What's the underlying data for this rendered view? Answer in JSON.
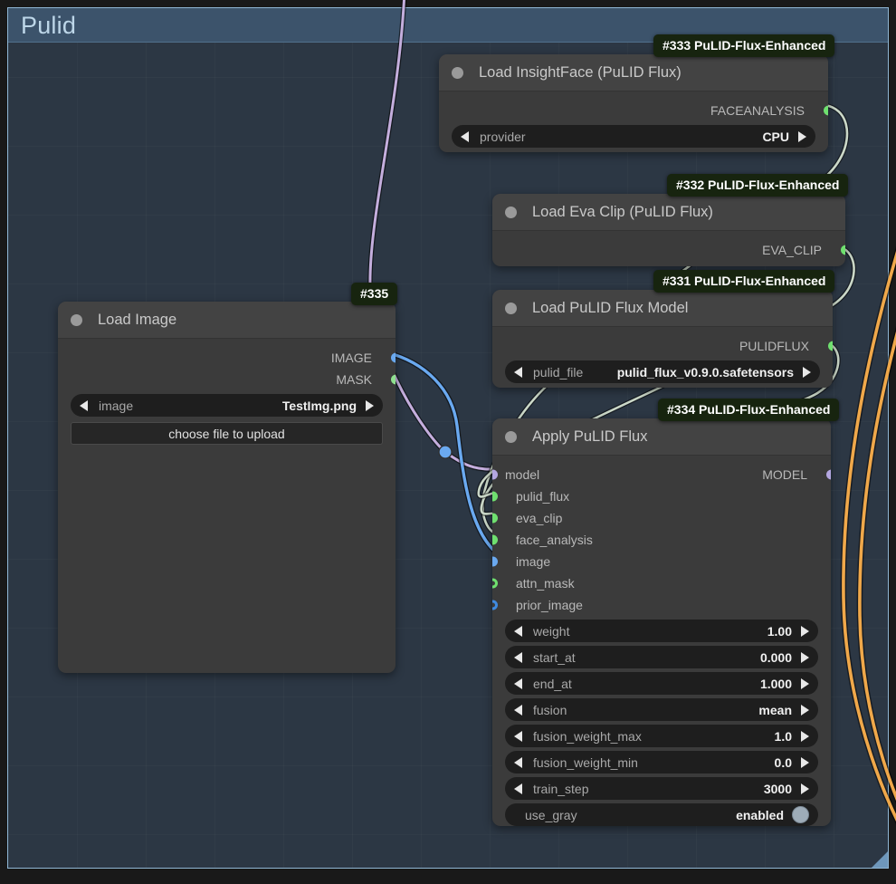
{
  "group": {
    "title": "Pulid",
    "frame_color": "#8fb6d4",
    "header_color": "#3c536b",
    "canvas_color": "#2c3744"
  },
  "colors": {
    "port_green": "#6fe06f",
    "port_blue": "#6aa9f0",
    "port_purple": "#b3a6e0",
    "wire_green": "#cbd8c8",
    "wire_blue": "#6aa9f0",
    "wire_purple": "#c4aedd",
    "wire_orange": "#f0a84a",
    "badge_bg": "#17240f"
  },
  "nodes": [
    {
      "id": "load-insightface",
      "badge": "#333 PuLID-Flux-Enhanced",
      "title": "Load InsightFace (PuLID Flux)",
      "outputs": [
        {
          "label": "FACEANALYSIS",
          "color": "#6fe06f",
          "style": "solid"
        }
      ],
      "inputs": [],
      "widgets": [
        {
          "kind": "combo",
          "label": "provider",
          "value": "CPU"
        }
      ]
    },
    {
      "id": "load-eva-clip",
      "badge": "#332 PuLID-Flux-Enhanced",
      "title": "Load Eva Clip (PuLID Flux)",
      "outputs": [
        {
          "label": "EVA_CLIP",
          "color": "#6fe06f",
          "style": "solid"
        }
      ],
      "inputs": [],
      "widgets": []
    },
    {
      "id": "load-pulid-flux-model",
      "badge": "#331 PuLID-Flux-Enhanced",
      "title": "Load PuLID Flux Model",
      "outputs": [
        {
          "label": "PULIDFLUX",
          "color": "#6fe06f",
          "style": "solid"
        }
      ],
      "inputs": [],
      "widgets": [
        {
          "kind": "combo",
          "label": "pulid_file",
          "value": "pulid_flux_v0.9.0.safetensors"
        }
      ]
    },
    {
      "id": "load-image",
      "badge": "#335",
      "title": "Load Image",
      "outputs": [
        {
          "label": "IMAGE",
          "color": "#6aa9f0",
          "style": "solid"
        },
        {
          "label": "MASK",
          "color": "#8fe08f",
          "style": "solid"
        }
      ],
      "inputs": [],
      "widgets": [
        {
          "kind": "combo",
          "label": "image",
          "value": "TestImg.png"
        },
        {
          "kind": "button",
          "label": "choose file to upload"
        }
      ]
    },
    {
      "id": "apply-pulid-flux",
      "badge": "#334 PuLID-Flux-Enhanced",
      "title": "Apply PuLID Flux",
      "inputs": [
        {
          "label": "model",
          "color": "#b3a6e0",
          "style": "solid"
        },
        {
          "label": "pulid_flux",
          "color": "#6fe06f",
          "style": "solid"
        },
        {
          "label": "eva_clip",
          "color": "#6fe06f",
          "style": "solid"
        },
        {
          "label": "face_analysis",
          "color": "#6fe06f",
          "style": "solid"
        },
        {
          "label": "image",
          "color": "#6aa9f0",
          "style": "solid"
        },
        {
          "label": "attn_mask",
          "color": "#6fe06f",
          "style": "hollow"
        },
        {
          "label": "prior_image",
          "color": "#6aa9f0",
          "style": "hollow"
        }
      ],
      "outputs": [
        {
          "label": "MODEL",
          "color": "#b3a6e0",
          "style": "solid"
        }
      ],
      "widgets": [
        {
          "kind": "combo",
          "label": "weight",
          "value": "1.00"
        },
        {
          "kind": "combo",
          "label": "start_at",
          "value": "0.000"
        },
        {
          "kind": "combo",
          "label": "end_at",
          "value": "1.000"
        },
        {
          "kind": "combo",
          "label": "fusion",
          "value": "mean"
        },
        {
          "kind": "combo",
          "label": "fusion_weight_max",
          "value": "1.0"
        },
        {
          "kind": "combo",
          "label": "fusion_weight_min",
          "value": "0.0"
        },
        {
          "kind": "combo",
          "label": "train_step",
          "value": "3000"
        },
        {
          "kind": "toggle",
          "label": "use_gray",
          "value": "enabled"
        }
      ]
    }
  ]
}
